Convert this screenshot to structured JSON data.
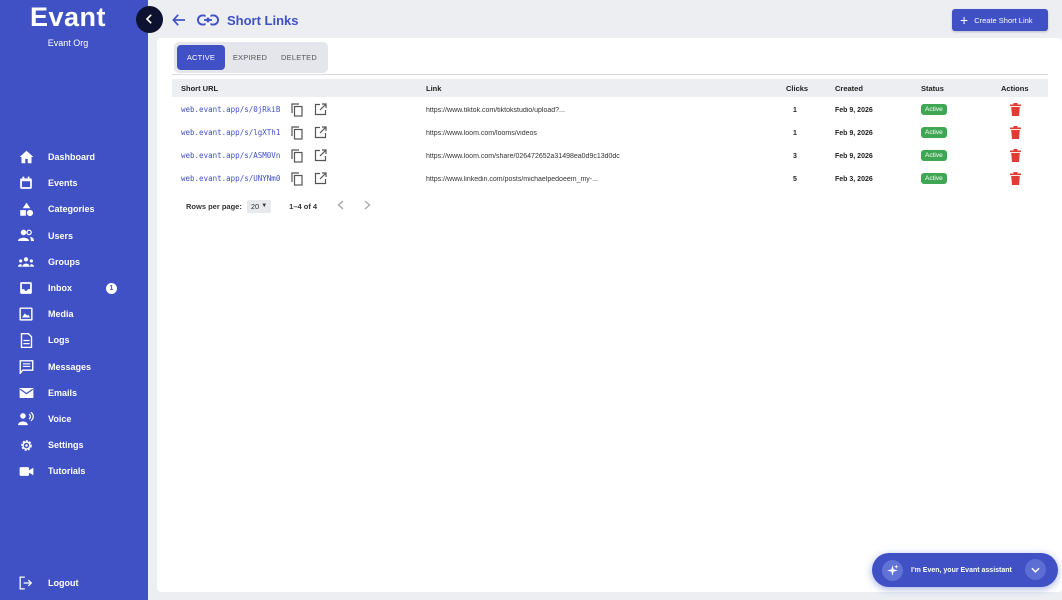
{
  "sidebar": {
    "brand": "Evant",
    "org": "Evant Org",
    "items": [
      {
        "label": "Dashboard",
        "icon": "home-icon"
      },
      {
        "label": "Events",
        "icon": "calendar-icon"
      },
      {
        "label": "Categories",
        "icon": "categories-icon"
      },
      {
        "label": "Users",
        "icon": "users-icon"
      },
      {
        "label": "Groups",
        "icon": "groups-icon"
      },
      {
        "label": "Inbox",
        "icon": "inbox-icon",
        "badge": "1"
      },
      {
        "label": "Media",
        "icon": "image-icon"
      },
      {
        "label": "Logs",
        "icon": "logs-icon"
      },
      {
        "label": "Messages",
        "icon": "message-icon"
      },
      {
        "label": "Emails",
        "icon": "mail-icon"
      },
      {
        "label": "Voice",
        "icon": "voice-icon"
      },
      {
        "label": "Settings",
        "icon": "gear-icon"
      },
      {
        "label": "Tutorials",
        "icon": "video-icon"
      }
    ],
    "logout": "Logout"
  },
  "header": {
    "title": "Short Links",
    "create_label": "Create Short Link"
  },
  "tabs": [
    {
      "label": "ACTIVE",
      "active": true
    },
    {
      "label": "EXPIRED",
      "active": false
    },
    {
      "label": "DELETED",
      "active": false
    }
  ],
  "table": {
    "columns": {
      "short_url": "Short URL",
      "link": "Link",
      "clicks": "Clicks",
      "created": "Created",
      "status": "Status",
      "actions": "Actions"
    },
    "rows": [
      {
        "short_url": "web.evant.app/s/0jRkiB",
        "link": "https://www.tiktok.com/tiktokstudio/upload?...",
        "clicks": "1",
        "created": "Feb 9, 2026",
        "status": "Active"
      },
      {
        "short_url": "web.evant.app/s/lgXTh1",
        "link": "https://www.loom.com/looms/videos",
        "clicks": "1",
        "created": "Feb 9, 2026",
        "status": "Active"
      },
      {
        "short_url": "web.evant.app/s/ASM0Vn",
        "link": "https://www.loom.com/share/026472652a31498ea0d9c13d0dc",
        "clicks": "3",
        "created": "Feb 9, 2026",
        "status": "Active"
      },
      {
        "short_url": "web.evant.app/s/UNYNm0",
        "link": "https://www.linkedin.com/posts/michaelpedoeem_my-...",
        "clicks": "5",
        "created": "Feb 3, 2026",
        "status": "Active"
      }
    ]
  },
  "pagination": {
    "rows_per_page_label": "Rows per page:",
    "rows_per_page": "20",
    "range": "1–4 of 4"
  },
  "assistant": {
    "text": "I'm Even, your Evant assistant"
  },
  "colors": {
    "primary": "#3f51c4",
    "status_active": "#3fa653",
    "delete": "#e53935"
  }
}
